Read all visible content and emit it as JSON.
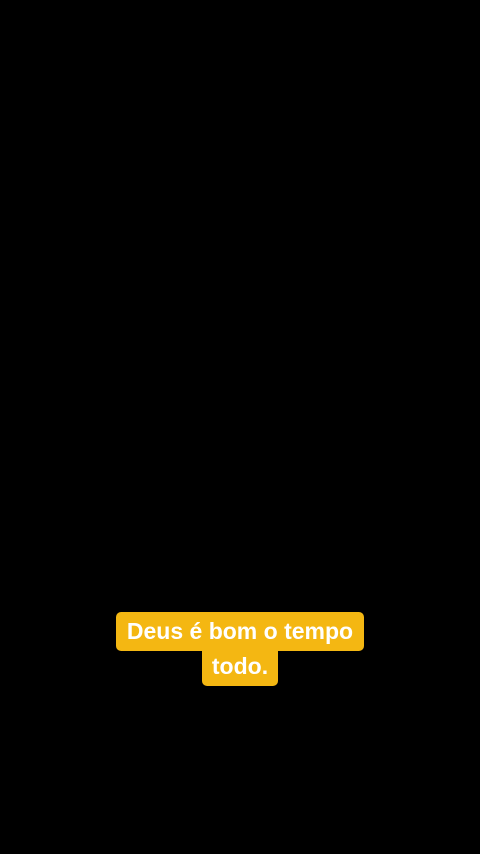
{
  "colors": {
    "background": "#000000",
    "caption_bg": "#f4b712",
    "caption_text": "#ffffff"
  },
  "caption": {
    "lines": [
      "Deus é bom o tempo",
      "todo."
    ]
  }
}
